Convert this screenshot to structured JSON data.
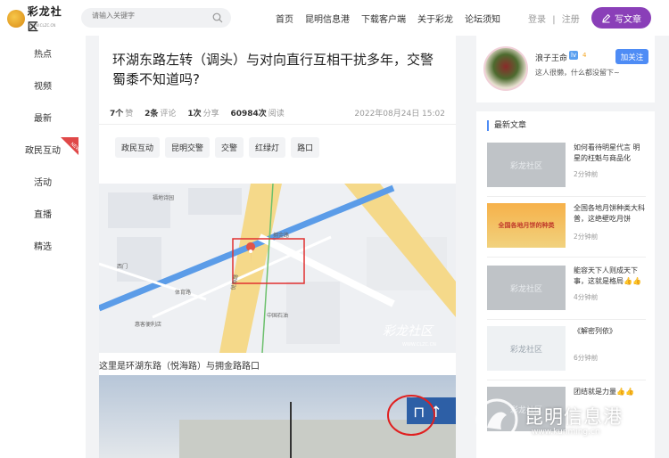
{
  "header": {
    "logo_text": "彩龙社区",
    "logo_sub": "WWW.CLZC.CN",
    "search_placeholder": "请输入关键字",
    "nav": [
      "首页",
      "昆明信息港",
      "下载客户端",
      "关于彩龙",
      "论坛须知"
    ],
    "login": "登录",
    "register": "注册",
    "write_button": "写文章",
    "accent": "#8a3fb8"
  },
  "sidebar": {
    "items": [
      "热点",
      "视频",
      "最新",
      "政民互动",
      "活动",
      "直播",
      "精选"
    ],
    "new_badge": "NEW"
  },
  "article": {
    "title": "环湖东路左转（调头）与对向直行互相干扰多年，交警蜀黍不知道吗?",
    "likes_count": "7个",
    "likes_label": "赞",
    "comments_count": "2条",
    "comments_label": "评论",
    "shares_count": "1次",
    "shares_label": "分享",
    "reads_count": "60984次",
    "reads_label": "阅读",
    "date": "2022年08月24日 15:02",
    "tags": [
      "政民互动",
      "昆明交警",
      "交警",
      "红绿灯",
      "路口"
    ],
    "map_watermark": "彩龙社区",
    "map_watermark_url": "WWW.CLZC.CN",
    "map_labels": [
      "悦海路",
      "拥金路",
      "西门",
      "中国石油",
      "体育路",
      "惠客便利店",
      "福地诗园"
    ],
    "caption": "这里是环湖东路（悦海路）与拥金路路口"
  },
  "profile": {
    "name": "浪子王命",
    "level_badge": "lv",
    "level": "4",
    "follow_button": "加关注",
    "bio": "这人很懒，什么都没留下~"
  },
  "latest": {
    "title": "最新文章",
    "articles": [
      {
        "title": "如何看待明星代言 明星的枉魁与商品化",
        "time": "2分钟前",
        "thumb": "彩龙社区"
      },
      {
        "title": "全国各地月饼种类大科普，这绝壁吃月饼",
        "time": "2分钟前",
        "thumb": "全国各地月饼的种类"
      },
      {
        "title": "能容天下人则成天下事，这就是格局👍👍",
        "time": "4分钟前",
        "thumb": "彩龙社区"
      },
      {
        "title": "《解密列依》",
        "time": "6分钟前",
        "thumb": "彩龙社区"
      },
      {
        "title": "团结就是力量👍👍",
        "time": "",
        "thumb": "彩龙社区"
      }
    ]
  },
  "brand": {
    "name": "昆明信息港",
    "url": "www.kunming.cn"
  }
}
